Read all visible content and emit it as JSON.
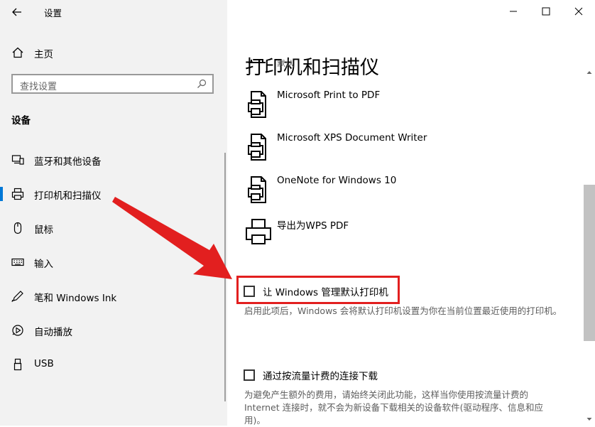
{
  "window": {
    "title": "设置",
    "controls": {
      "minimize": "minimize-icon",
      "maximize": "maximize-icon",
      "close": "close-icon"
    }
  },
  "sidebar": {
    "home_label": "主页",
    "search_placeholder": "查找设置",
    "section_title": "设备",
    "items": [
      {
        "label": "蓝牙和其他设备",
        "icon": "bluetooth-devices-icon"
      },
      {
        "label": "打印机和扫描仪",
        "icon": "printer-icon",
        "selected": true
      },
      {
        "label": "鼠标",
        "icon": "mouse-icon"
      },
      {
        "label": "输入",
        "icon": "keyboard-icon"
      },
      {
        "label": "笔和 Windows Ink",
        "icon": "pen-icon"
      },
      {
        "label": "自动播放",
        "icon": "autoplay-icon"
      },
      {
        "label": "USB",
        "icon": "usb-icon"
      }
    ]
  },
  "main": {
    "page_title": "打印机和扫描仪",
    "cut_off_text": "默认",
    "printers": [
      {
        "name": "Microsoft Print to PDF"
      },
      {
        "name": "Microsoft XPS Document Writer"
      },
      {
        "name": "OneNote for Windows 10"
      },
      {
        "name": "导出为WPS PDF"
      }
    ],
    "let_windows_manage": {
      "label": "让 Windows 管理默认打印机",
      "checked": false,
      "description": "启用此项后，Windows 会将默认打印机设置为你在当前位置最近使用的打印机。"
    },
    "metered_download": {
      "label": "通过按流量计费的连接下载",
      "checked": false,
      "description": "为避免产生额外的费用，请始终关闭此功能，这样当你使用按流量计费的 Internet 连接时，就不会为新设备下载相关的设备软件(驱动程序、信息和应用)。"
    }
  },
  "colors": {
    "accent": "#0078d7",
    "annotation_red": "#e21f1f",
    "sidebar_bg": "#f2f2f2"
  }
}
